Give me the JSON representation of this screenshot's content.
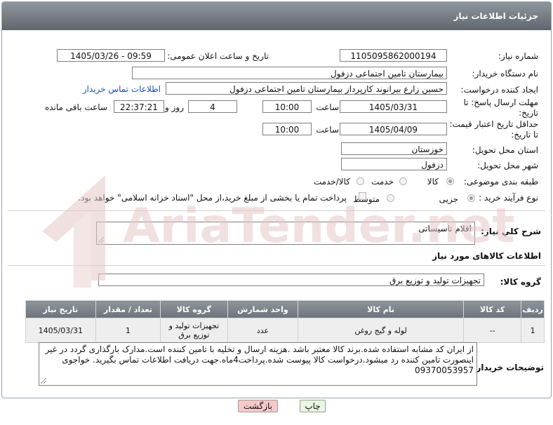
{
  "header": {
    "title": "جزئیات اطلاعات نیاز"
  },
  "form": {
    "need_number_label": "شماره نیاز:",
    "need_number": "1105095862000194",
    "announce_label": "تاریخ و ساعت اعلان عمومی:",
    "announce_value": "1405/03/26 - 09:59",
    "buyer_org_label": "نام دستگاه خریدار:",
    "buyer_org": "بیمارستان تامین اجتماعی دزفول",
    "creator_label": "ایجاد کننده درخواست:",
    "creator": "حسین زارع بیرانوند کارپرداز بیمارستان تامین اجتماعی دزفول",
    "buyer_contact_link": "اطلاعات تماس خریدار",
    "reply_deadline_label": "مهلت ارسال پاسخ: تا تاریخ:",
    "reply_date": "1405/03/31",
    "time_label": "ساعت",
    "reply_time": "10:00",
    "days_value": "4",
    "days_label": "روز و",
    "remaining_time": "22:37:21",
    "remaining_label": "ساعت باقی مانده",
    "price_deadline_label": "حداقل تاریخ اعتبار قیمت: تا تاریخ:",
    "price_date": "1405/04/09",
    "price_time": "10:00",
    "province_label": "استان محل تحویل:",
    "province": "خوزستان",
    "city_label": "شهر محل تحویل:",
    "city": "دزفول",
    "category_label": "طبقه بندی موضوعی:",
    "category_options": [
      "کالا",
      "خدمت",
      "کالا/خدمت"
    ],
    "purchase_type_label": "نوع فرآیند خرید :",
    "purchase_options": [
      "جزیی",
      "متوسط"
    ],
    "payment_note": "پرداخت تمام یا بخشی از مبلغ خرید،از محل \"اسناد خزانه اسلامی\" خواهد بود."
  },
  "need_desc": {
    "label": "شرح کلي نياز:",
    "value": "اقلام تاسیساتی"
  },
  "goods_section_title": "اطلاعات کالاهای مورد نیاز",
  "goods_group": {
    "label": "گروه کالا:",
    "value": "تجهیزات تولید و توزیع برق"
  },
  "table": {
    "headers": [
      "ردیف",
      "کد کالا",
      "نام کالا",
      "واحد شمارش",
      "گروه کالا",
      "تعداد / مقدار",
      "تاریخ نیاز"
    ],
    "rows": [
      [
        "1",
        "--",
        "لوله و گیج روغن",
        "عدد",
        "تجهیزات تولید و توزیع برق",
        "1",
        "1405/03/31"
      ]
    ]
  },
  "buyer_notes": {
    "label": "توضیحات خریدار:",
    "value": "از ایران کد مشابه استفاده شده.برند کالا معتبر باشد .هزینه ارسال و تخلیه با تامین کننده است.مدارک بارگذاری گردد در غیر اینصورت تامین کننده رد میشود.درخواست کالا پیوست شده.پرداخت4ماه.جهت دریافت اطلاعات تماس بگیرید. خواجوی 09370053957"
  },
  "buttons": {
    "print": "چاپ",
    "back": "بازگشت"
  },
  "watermark": "AriaTender.net",
  "colors": {
    "header": "#6f767d",
    "link": "#1a4fb5",
    "back_btn": "#f6c9c9",
    "print_btn": "#e9f6e2",
    "watermark": "#e6c7c7"
  }
}
